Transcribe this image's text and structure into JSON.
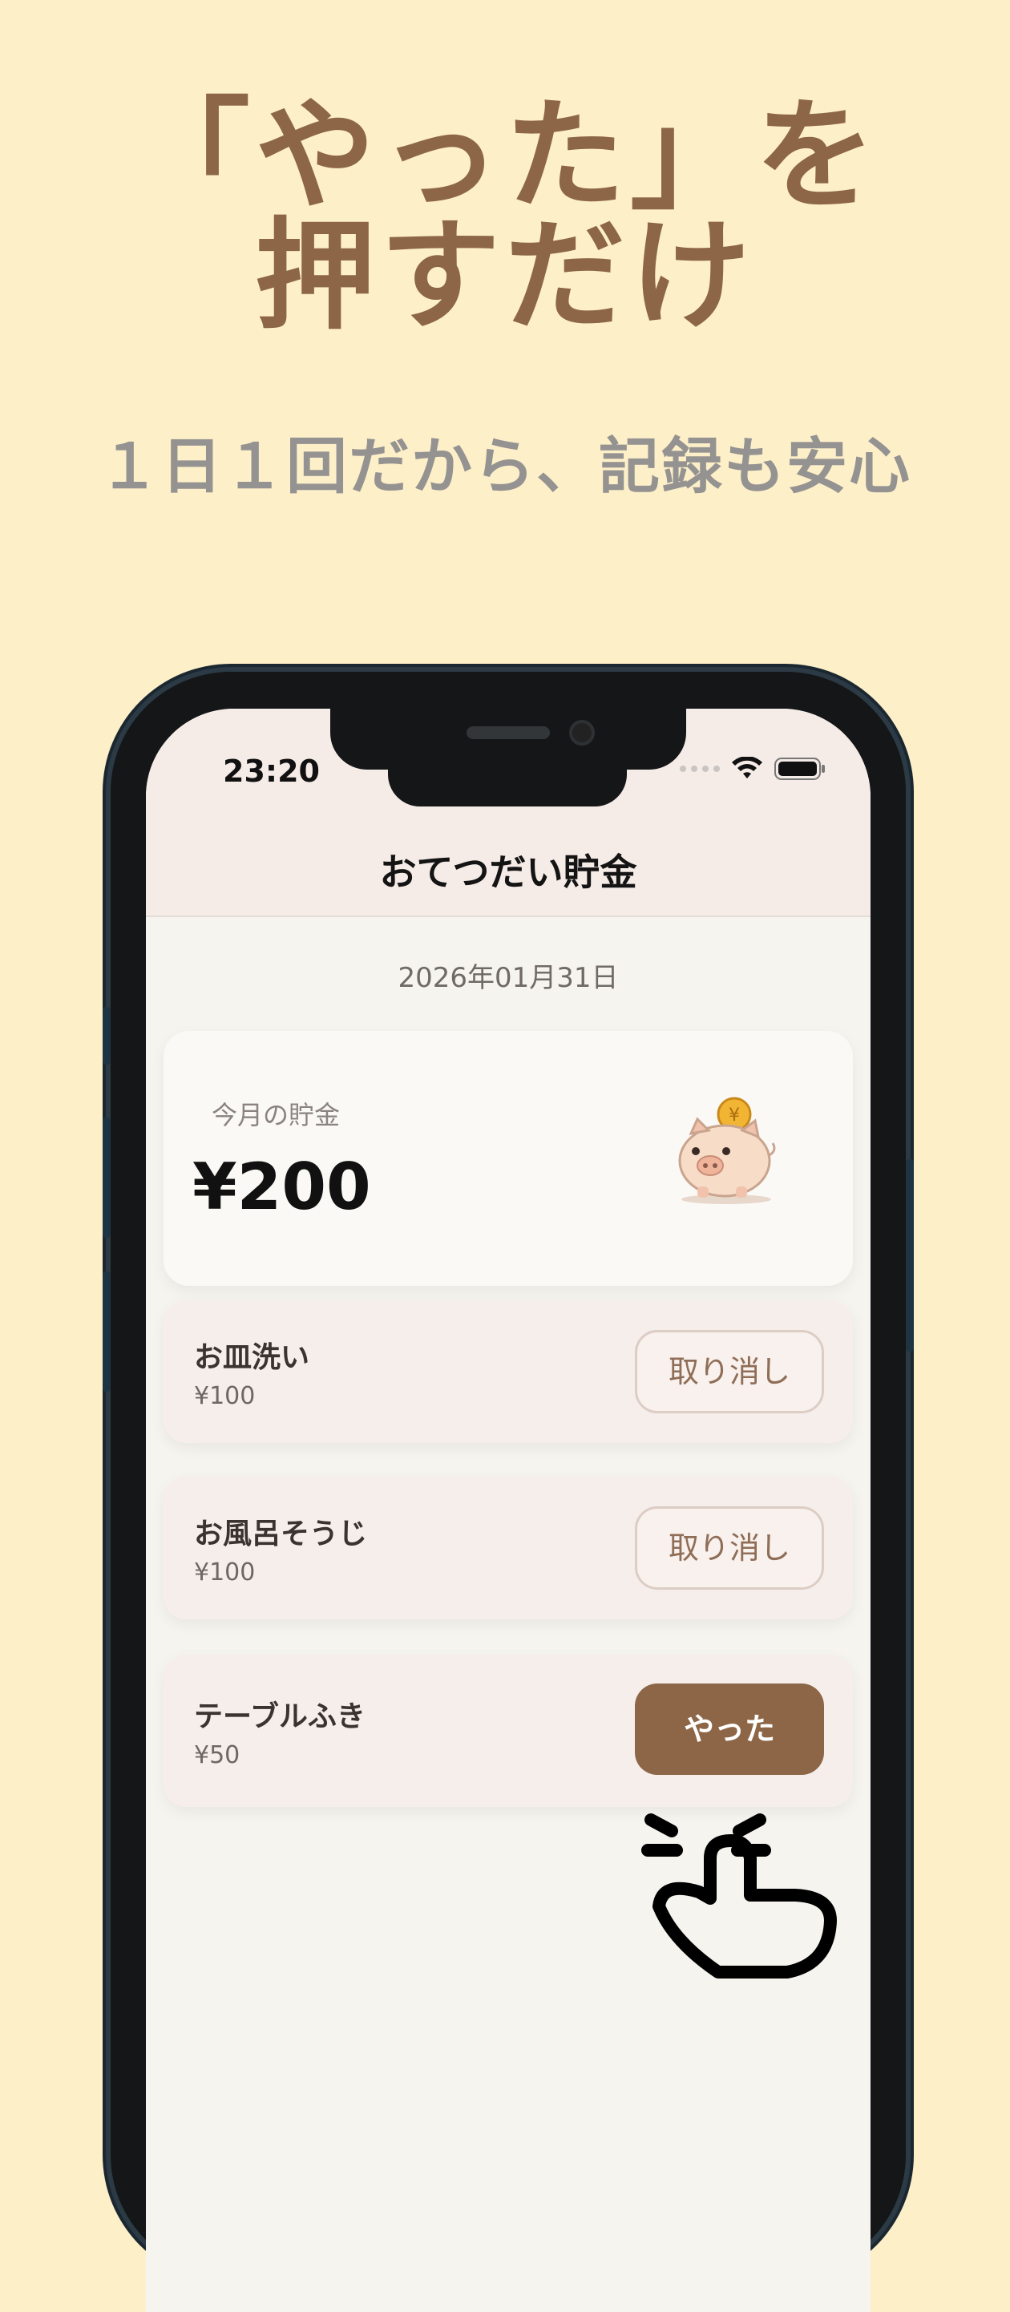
{
  "promo": {
    "headline_line1": "「やった」を",
    "headline_line2": "押すだけ",
    "subheadline": "１日１回だから、記録も安心"
  },
  "status_bar": {
    "time": "23:20"
  },
  "app": {
    "title": "おてつだい貯金",
    "date": "2026年01月31日",
    "savings": {
      "label": "今月の貯金",
      "amount": "¥200"
    },
    "tasks": [
      {
        "name": "お皿洗い",
        "price": "¥100",
        "button": "取り消し",
        "state": "done"
      },
      {
        "name": "お風呂そうじ",
        "price": "¥100",
        "button": "取り消し",
        "state": "done"
      },
      {
        "name": "テーブルふき",
        "price": "¥50",
        "button": "やった",
        "state": "pending"
      }
    ]
  },
  "colors": {
    "background": "#fdefc8",
    "accent_brown": "#8c6647",
    "subtext_gray": "#959391"
  },
  "icons": [
    "wifi-icon",
    "battery-icon",
    "piggy-bank-icon",
    "tap-hand-icon"
  ]
}
